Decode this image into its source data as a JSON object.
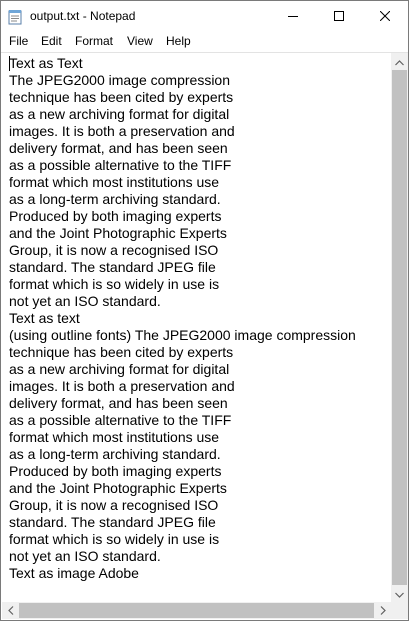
{
  "window": {
    "title": "output.txt - Notepad"
  },
  "icons": {
    "app": "notepad-icon",
    "minimize": "minimize-icon",
    "maximize": "maximize-icon",
    "close": "close-icon"
  },
  "menu": {
    "items": [
      "File",
      "Edit",
      "Format",
      "View",
      "Help"
    ]
  },
  "document": {
    "lines": [
      "Text as Text",
      "The JPEG2000 image compression",
      "technique has been cited by experts",
      "as a new archiving format for digital",
      "images. It is both a preservation and",
      "delivery format, and has been seen",
      "as a possible alternative to the TIFF",
      "format which most institutions use",
      "as a long-term archiving standard.",
      "Produced by both imaging experts",
      "and the Joint Photographic Experts",
      "Group, it is now a recognised ISO",
      "standard. The standard JPEG file",
      "format which is so widely in use is",
      "not yet an ISO standard.",
      "Text as text",
      "(using outline fonts) The JPEG2000 image compression",
      "technique has been cited by experts",
      "as a new archiving format for digital",
      "images. It is both a preservation and",
      "delivery format, and has been seen",
      "as a possible alternative to the TIFF",
      "format which most institutions use",
      "as a long-term archiving standard.",
      "Produced by both imaging experts",
      "and the Joint Photographic Experts",
      "Group, it is now a recognised ISO",
      "standard. The standard JPEG file",
      "format which is so widely in use is",
      "not yet an ISO standard.",
      "Text as image Adobe"
    ]
  }
}
